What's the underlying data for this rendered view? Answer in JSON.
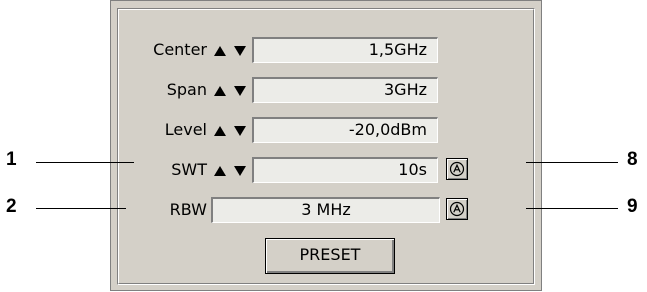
{
  "rows": [
    {
      "label": "Center",
      "value": "1,5GHz"
    },
    {
      "label": "Span",
      "value": "3GHz"
    },
    {
      "label": "Level",
      "value": "-20,0dBm"
    },
    {
      "label": "SWT",
      "value": "10s"
    }
  ],
  "rbw": {
    "label": "RBW",
    "value": "3 MHz"
  },
  "preset_label": "PRESET",
  "callouts": {
    "left_swt": "1",
    "left_rbw": "2",
    "right_swt": "8",
    "right_rbw": "9"
  },
  "icons": {
    "up": "arrow-up-icon",
    "down": "arrow-down-icon",
    "auto": "auto-icon"
  }
}
